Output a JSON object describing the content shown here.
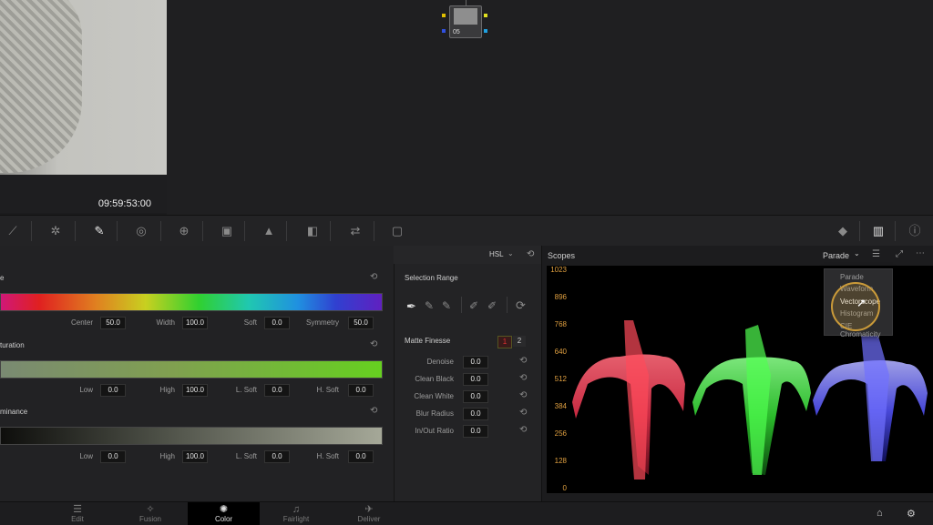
{
  "viewer": {
    "timecode": "09:59:53:00"
  },
  "node": {
    "label": "05"
  },
  "panel": {
    "mode": "HSL"
  },
  "hsl": {
    "hue": {
      "title": "e",
      "center_label": "Center",
      "center": "50.0",
      "width_label": "Width",
      "width": "100.0",
      "soft_label": "Soft",
      "soft": "0.0",
      "symmetry_label": "Symmetry",
      "symmetry": "50.0"
    },
    "saturation": {
      "title": "turation",
      "low_label": "Low",
      "low": "0.0",
      "high_label": "High",
      "high": "100.0",
      "lsoft_label": "L. Soft",
      "lsoft": "0.0",
      "hsoft_label": "H. Soft",
      "hsoft": "0.0"
    },
    "luminance": {
      "title": "minance",
      "low_label": "Low",
      "low": "0.0",
      "high_label": "High",
      "high": "100.0",
      "lsoft_label": "L. Soft",
      "lsoft": "0.0",
      "hsoft_label": "H. Soft",
      "hsoft": "0.0"
    }
  },
  "selection": {
    "title": "Selection Range",
    "matte_title": "Matte Finesse",
    "tab1": "1",
    "tab2": "2",
    "rows": [
      {
        "label": "Denoise",
        "value": "0.0"
      },
      {
        "label": "Clean Black",
        "value": "0.0"
      },
      {
        "label": "Clean White",
        "value": "0.0"
      },
      {
        "label": "Blur Radius",
        "value": "0.0"
      },
      {
        "label": "In/Out Ratio",
        "value": "0.0"
      }
    ]
  },
  "scopes": {
    "title": "Scopes",
    "mode": "Parade",
    "dropdown": [
      "Parade",
      "Waveform",
      "Vectorscope",
      "Histogram",
      "CIE Chromaticity"
    ],
    "yticks": [
      "1023",
      "896",
      "768",
      "640",
      "512",
      "384",
      "256",
      "128",
      "0"
    ]
  },
  "pages": [
    "Edit",
    "Fusion",
    "Color",
    "Fairlight",
    "Deliver"
  ],
  "colors": {
    "accent_red": "#e03030",
    "tick": "#e0a040"
  }
}
